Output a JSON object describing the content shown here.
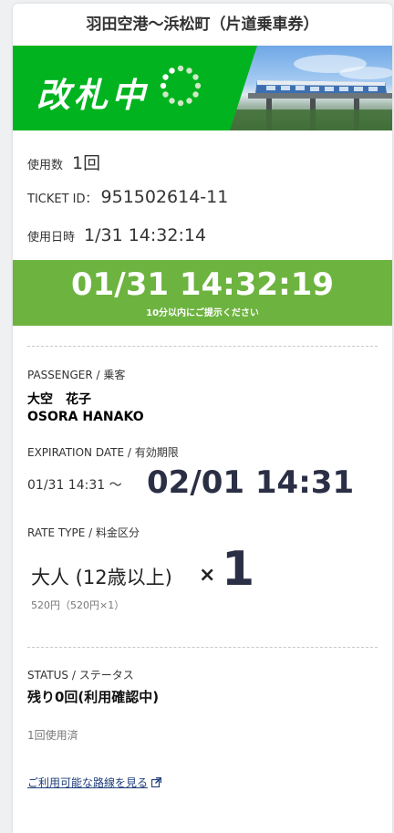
{
  "title": "羽田空港〜浜松町（片道乗車券）",
  "banner": {
    "status_text": "改札中",
    "status_icon": "loading-spinner-icon"
  },
  "info": {
    "usage_count_label": "使用数",
    "usage_count_value": "1回",
    "ticket_id_label": "TICKET ID：",
    "ticket_id_value": "951502614-11",
    "used_at_label": "使用日時",
    "used_at_value": "1/31 14:32:14"
  },
  "timer": {
    "current_time": "01/31 14:32:19",
    "note": "10分以内にご提示ください"
  },
  "passenger": {
    "label": "PASSENGER / 乗客",
    "name_jp": "大空　花子",
    "name_en": "OSORA HANAKO"
  },
  "expiration": {
    "label": "EXPIRATION DATE / 有効期限",
    "from": "01/31 14:31 〜",
    "to": "02/01 14:31"
  },
  "rate": {
    "label": "RATE TYPE / 料金区分",
    "type": "大人 (12歳以上)",
    "times": "×",
    "quantity": "1",
    "price": "520円（520円×1）"
  },
  "status": {
    "label": "STATUS / ステータス",
    "value": "残り0回(利用確認中)",
    "sub": "1回使用済"
  },
  "link": {
    "text": "ご利用可能な路線を見る",
    "icon": "external-link-icon"
  },
  "colors": {
    "banner_green": "#00b31f",
    "timer_green": "#6db33f",
    "dark_text": "#2b2f45",
    "link_blue": "#1f3f7a"
  }
}
